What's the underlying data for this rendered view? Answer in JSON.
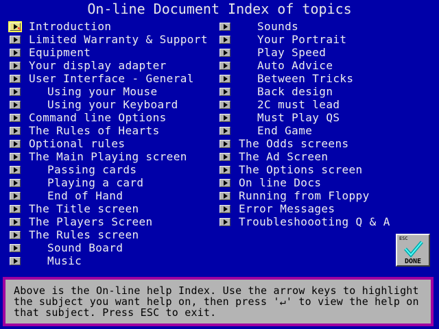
{
  "window": {
    "title": "On-line Document Index of topics"
  },
  "topics_left": [
    {
      "label": "Introduction",
      "indent": false,
      "selected": true
    },
    {
      "label": "Limited Warranty & Support",
      "indent": false
    },
    {
      "label": "Equipment",
      "indent": false
    },
    {
      "label": "Your display adapter",
      "indent": false
    },
    {
      "label": "User Interface - General",
      "indent": false
    },
    {
      "label": "Using your Mouse",
      "indent": true
    },
    {
      "label": "Using your Keyboard",
      "indent": true
    },
    {
      "label": "Command line Options",
      "indent": false
    },
    {
      "label": "The Rules of Hearts",
      "indent": false
    },
    {
      "label": "Optional rules",
      "indent": false
    },
    {
      "label": "The Main Playing screen",
      "indent": false
    },
    {
      "label": "Passing cards",
      "indent": true
    },
    {
      "label": "Playing a card",
      "indent": true
    },
    {
      "label": "End of Hand",
      "indent": true
    },
    {
      "label": "The Title screen",
      "indent": false
    },
    {
      "label": "The Players Screen",
      "indent": false
    },
    {
      "label": "The Rules screen",
      "indent": false
    },
    {
      "label": "Sound Board",
      "indent": true
    },
    {
      "label": "Music",
      "indent": true
    }
  ],
  "topics_right": [
    {
      "label": "Sounds",
      "indent": true
    },
    {
      "label": "Your Portrait",
      "indent": true
    },
    {
      "label": "Play Speed",
      "indent": true
    },
    {
      "label": "Auto Advice",
      "indent": true
    },
    {
      "label": "Between Tricks",
      "indent": true
    },
    {
      "label": "Back design",
      "indent": true
    },
    {
      "label": "2C must lead",
      "indent": true
    },
    {
      "label": "Must Play QS",
      "indent": true
    },
    {
      "label": "End Game",
      "indent": true
    },
    {
      "label": "The Odds screens",
      "indent": false
    },
    {
      "label": "The Ad Screen",
      "indent": false
    },
    {
      "label": "The Options screen",
      "indent": false
    },
    {
      "label": "On line Docs",
      "indent": false
    },
    {
      "label": "Running from Floppy",
      "indent": false
    },
    {
      "label": "Error Messages",
      "indent": false
    },
    {
      "label": "Troubleshoooting Q & A",
      "indent": false
    }
  ],
  "done_button": {
    "esc_label": "ESC",
    "label": "DONE"
  },
  "help_text": {
    "line1": "Above is the On-line help Index. Use the arrow keys to highlight",
    "line2": "the subject you want help on, then press '↵' to view the help on",
    "line3": "that subject. Press ESC to exit."
  },
  "icons": {
    "topic_button": "triangle-right-icon",
    "done_check": "checkmark-icon",
    "mouse_cursor": "cursor-icon"
  },
  "colors": {
    "background": "#0000a8",
    "text": "#efefef",
    "panel_border": "#a000a0",
    "panel_bg": "#b4b4b4"
  }
}
